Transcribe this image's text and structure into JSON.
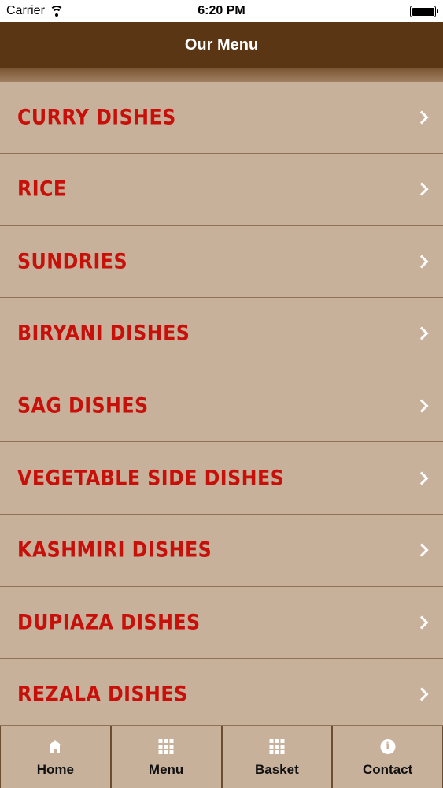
{
  "status_bar": {
    "carrier": "Carrier",
    "time": "6:20 PM"
  },
  "nav_bar": {
    "title": "Our Menu"
  },
  "menu_items": [
    {
      "label": "CURRY DISHES"
    },
    {
      "label": "RICE"
    },
    {
      "label": "SUNDRIES"
    },
    {
      "label": "BIRYANI DISHES"
    },
    {
      "label": "SAG DISHES"
    },
    {
      "label": "VEGETABLE SIDE DISHES"
    },
    {
      "label": "KASHMIRI DISHES"
    },
    {
      "label": "DUPIAZA DISHES"
    },
    {
      "label": "REZALA DISHES"
    }
  ],
  "tab_bar": {
    "tabs": [
      {
        "label": "Home",
        "icon": "home-icon"
      },
      {
        "label": "Menu",
        "icon": "grid-icon"
      },
      {
        "label": "Basket",
        "icon": "grid-icon"
      },
      {
        "label": "Contact",
        "icon": "info-icon"
      }
    ]
  },
  "colors": {
    "nav_background": "#5a3615",
    "list_background": "#c8b19a",
    "item_text": "#c8100b",
    "chevron": "#ffffff"
  }
}
